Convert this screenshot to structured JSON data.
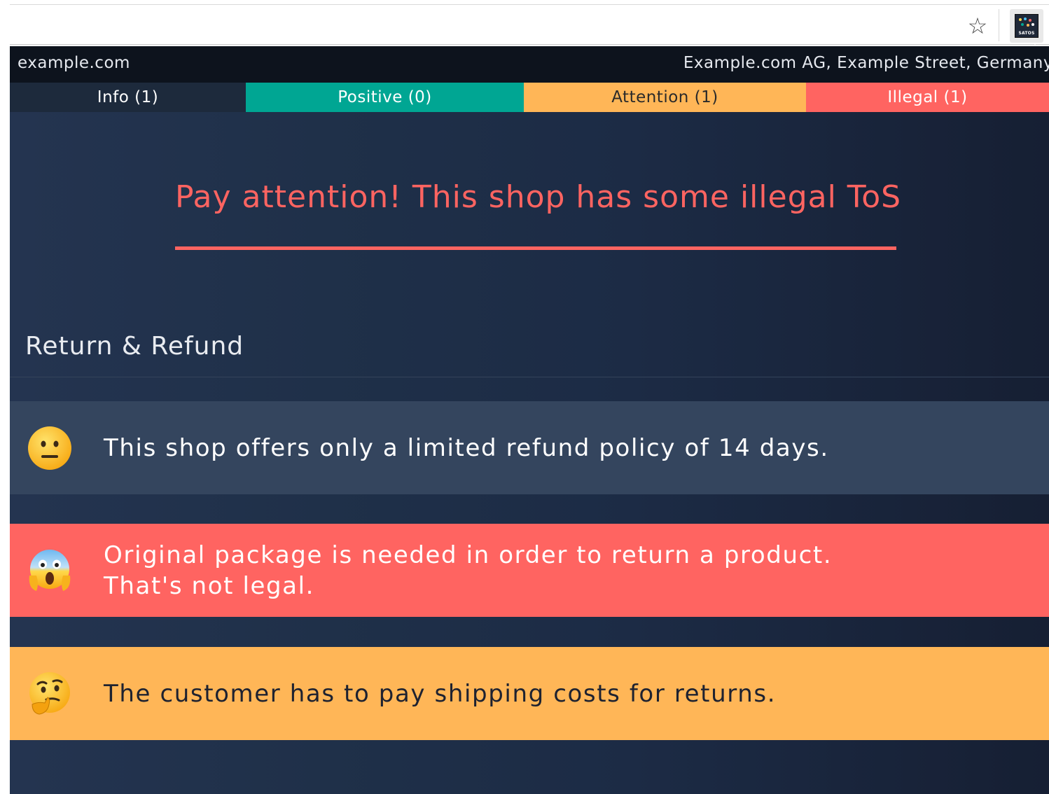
{
  "browser": {
    "star_icon": "star-outline-icon",
    "extension_name": "SATOS"
  },
  "header": {
    "domain": "example.com",
    "company": "Example.com AG, Example Street, Germany"
  },
  "tabs": [
    {
      "label": "Info (1)",
      "color": "#1d2a3c"
    },
    {
      "label": "Positive (0)",
      "color": "#00a693"
    },
    {
      "label": "Attention (1)",
      "color": "#ffb657"
    },
    {
      "label": "Illegal (1)",
      "color": "#ff6461"
    }
  ],
  "headline": "Pay attention! This shop has some illegal ToS",
  "section": {
    "title": "Return & Refund",
    "items": [
      {
        "type": "info",
        "emoji": "neutral-face-icon",
        "text": "This shop offers only a limited refund policy of 14 days.",
        "color": "#34455e"
      },
      {
        "type": "illegal",
        "emoji": "screaming-face-icon",
        "text_line1": "Original package is needed in order to return a product.",
        "text_line2": "That's not legal.",
        "color": "#ff6461"
      },
      {
        "type": "attention",
        "emoji": "thinking-face-icon",
        "text": "The customer has to pay shipping costs for returns.",
        "color": "#ffb657"
      }
    ]
  },
  "colors": {
    "illegal": "#ff6461",
    "attention": "#ffb657",
    "positive": "#00a693",
    "background": "#1f3049"
  }
}
